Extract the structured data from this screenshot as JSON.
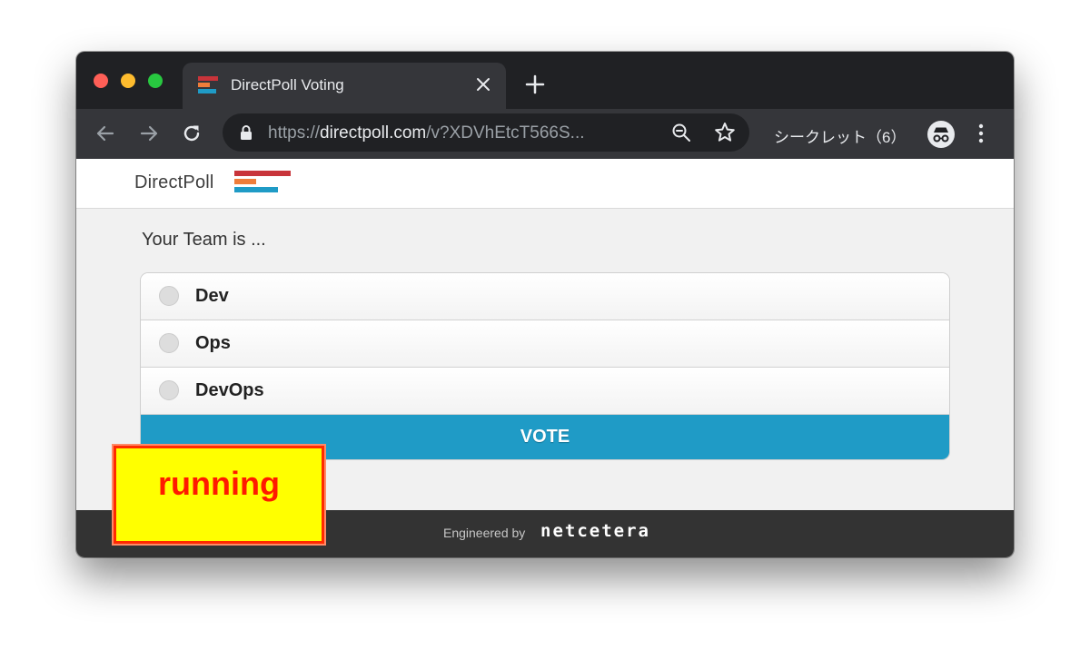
{
  "browser": {
    "tab": {
      "title": "DirectPoll Voting",
      "favicon_colors": [
        "#c8343a",
        "#ef7d3a",
        "#1f9bc6"
      ]
    },
    "new_tab_icon": "plus-icon",
    "nav_icons": [
      "arrow-left-icon",
      "arrow-right-icon",
      "reload-icon"
    ],
    "address": {
      "scheme": "https://",
      "host": "directpoll.com",
      "path": "/v?XDVhEtcT566S..."
    },
    "incognito_label": "シークレット（6）",
    "incognito_icon": "incognito-icon",
    "menu_icon": "more-vert-icon"
  },
  "site": {
    "brand_name": "DirectPoll",
    "logo_colors": [
      "#c8343a",
      "#ef7d3a",
      "#1f9bc6"
    ]
  },
  "poll": {
    "question": "Your Team is ...",
    "options": [
      {
        "label": "Dev"
      },
      {
        "label": "Ops"
      },
      {
        "label": "DevOps"
      }
    ],
    "vote_label": "VOTE",
    "vote_color": "#1f9bc6"
  },
  "footer": {
    "credit": "Engineered by",
    "brand": "netcetera"
  },
  "overlay": {
    "label": "running",
    "background": "#ffff00",
    "text_color": "#ff1a00"
  }
}
